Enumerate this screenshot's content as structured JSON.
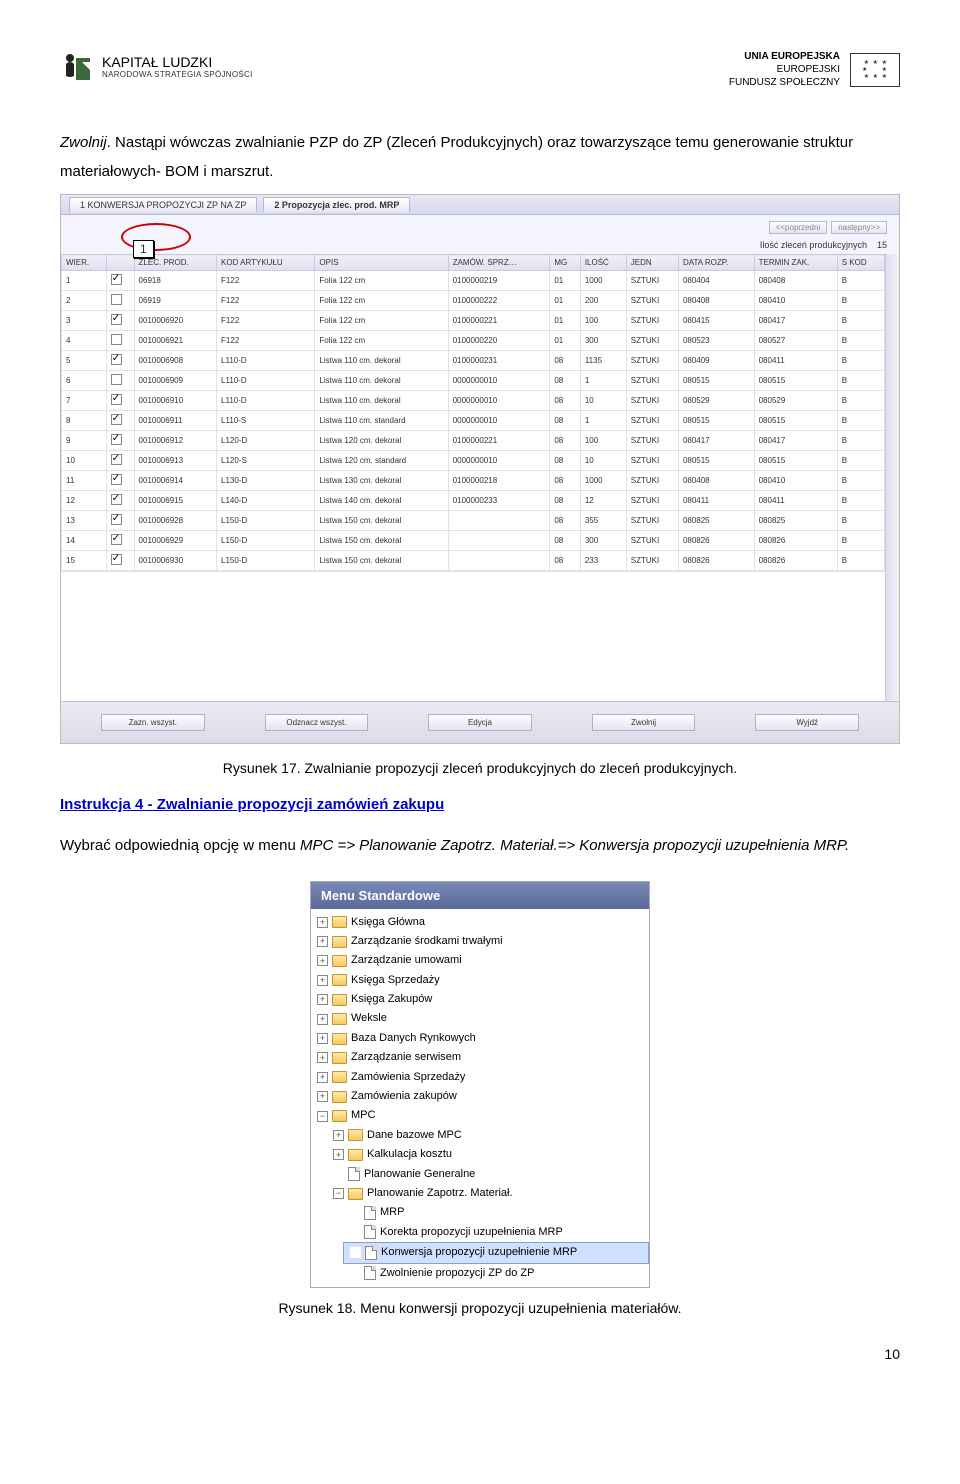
{
  "header": {
    "kl_title": "KAPITAŁ LUDZKI",
    "kl_sub": "NARODOWA STRATEGIA SPÓJNOŚCI",
    "eu_line1": "UNIA EUROPEJSKA",
    "eu_line2": "EUROPEJSKI",
    "eu_line3": "FUNDUSZ SPOŁECZNY"
  },
  "para1_a": "Zwolnij",
  "para1_b": ". Nastąpi wówczas zwalnianie PZP do ZP (Zleceń Produkcyjnych) oraz towarzyszące temu generowanie struktur materiałowych- BOM i marszrut.",
  "callout_num": "1",
  "app": {
    "tab1": "1 KONWERSJA PROPOZYCJI ZP NA ZP",
    "tab2": "2 Propozycja zlec. prod. MRP",
    "prev": "<<poprzedni",
    "next": "następny>>",
    "count_label": "Ilość zleceń produkcyjnych",
    "count_val": "15",
    "columns": [
      "WIER.",
      "",
      "ZLEC. PROD.",
      "KOD ARTYKUŁU",
      "OPIS",
      "ZAMÓW. SPRZ…",
      "MG",
      "ILOŚĆ",
      "JEDN",
      "DATA ROZP.",
      "TERMIN ZAK.",
      "S KOD"
    ],
    "rows": [
      [
        "1",
        true,
        "06918",
        "F122",
        "Folia 122 cm",
        "0100000219",
        "01",
        "1000",
        "SZTUKI",
        "080404",
        "080408",
        "B"
      ],
      [
        "2",
        false,
        "06919",
        "F122",
        "Folia 122 cm",
        "0100000222",
        "01",
        "200",
        "SZTUKI",
        "080408",
        "080410",
        "B"
      ],
      [
        "3",
        true,
        "0010006920",
        "F122",
        "Folia 122 cm",
        "0100000221",
        "01",
        "100",
        "SZTUKI",
        "080415",
        "080417",
        "B"
      ],
      [
        "4",
        false,
        "0010006921",
        "F122",
        "Folia 122 cm",
        "0100000220",
        "01",
        "300",
        "SZTUKI",
        "080523",
        "080527",
        "B"
      ],
      [
        "5",
        true,
        "0010006908",
        "L110-D",
        "Listwa 110 cm. dekoral",
        "0100000231",
        "08",
        "1135",
        "SZTUKI",
        "080409",
        "080411",
        "B"
      ],
      [
        "6",
        false,
        "0010006909",
        "L110-D",
        "Listwa 110 cm. dekoral",
        "0000000010",
        "08",
        "1",
        "SZTUKI",
        "080515",
        "080515",
        "B"
      ],
      [
        "7",
        true,
        "0010006910",
        "L110-D",
        "Listwa 110 cm. dekoral",
        "0000000010",
        "08",
        "10",
        "SZTUKI",
        "080529",
        "080529",
        "B"
      ],
      [
        "8",
        true,
        "0010006911",
        "L110-S",
        "Listwa 110 cm. standard",
        "0000000010",
        "08",
        "1",
        "SZTUKI",
        "080515",
        "080515",
        "B"
      ],
      [
        "9",
        true,
        "0010006912",
        "L120-D",
        "Listwa 120 cm. dekoral",
        "0100000221",
        "08",
        "100",
        "SZTUKI",
        "080417",
        "080417",
        "B"
      ],
      [
        "10",
        true,
        "0010006913",
        "L120-S",
        "Listwa 120 cm. standard",
        "0000000010",
        "08",
        "10",
        "SZTUKI",
        "080515",
        "080515",
        "B"
      ],
      [
        "11",
        true,
        "0010006914",
        "L130-D",
        "Listwa 130 cm. dekoral",
        "0100000218",
        "08",
        "1000",
        "SZTUKI",
        "080408",
        "080410",
        "B"
      ],
      [
        "12",
        true,
        "0010006915",
        "L140-D",
        "Listwa 140 cm. dekoral",
        "0100000233",
        "08",
        "12",
        "SZTUKI",
        "080411",
        "080411",
        "B"
      ],
      [
        "13",
        true,
        "0010006928",
        "L150-D",
        "Listwa 150 cm. dekoral",
        "",
        "08",
        "355",
        "SZTUKI",
        "080825",
        "080825",
        "B"
      ],
      [
        "14",
        true,
        "0010006929",
        "L150-D",
        "Listwa 150 cm. dekoral",
        "",
        "08",
        "300",
        "SZTUKI",
        "080826",
        "080826",
        "B"
      ],
      [
        "15",
        true,
        "0010006930",
        "L150-D",
        "Listwa 150 cm. dekoral",
        "",
        "08",
        "233",
        "SZTUKI",
        "080826",
        "080826",
        "B"
      ]
    ],
    "buttons": [
      "Zazn. wszyst.",
      "Odznacz wszyst.",
      "Edycja",
      "Zwolnij",
      "Wyjdź"
    ]
  },
  "caption1": "Rysunek 17. Zwalnianie propozycji zleceń produkcyjnych do zleceń produkcyjnych.",
  "instr4": "Instrukcja 4 - Zwalnianie propozycji zamówień zakupu",
  "para2_a": "Wybrać odpowiednią opcję w menu ",
  "para2_b": "MPC => Planowanie Zapotrz. Materiał.=> Konwersja propozycji uzupełnienia MRP.",
  "menu": {
    "title": "Menu Standardowe",
    "items": [
      {
        "t": "plus",
        "icon": "folder",
        "label": "Księga Główna",
        "ind": 0
      },
      {
        "t": "plus",
        "icon": "folder",
        "label": "Zarządzanie środkami trwałymi",
        "ind": 0
      },
      {
        "t": "plus",
        "icon": "folder",
        "label": "Zarządzanie umowami",
        "ind": 0
      },
      {
        "t": "plus",
        "icon": "folder",
        "label": "Księga Sprzedaży",
        "ind": 0
      },
      {
        "t": "plus",
        "icon": "folder",
        "label": "Księga Zakupów",
        "ind": 0
      },
      {
        "t": "plus",
        "icon": "folder",
        "label": "Weksle",
        "ind": 0
      },
      {
        "t": "plus",
        "icon": "folder",
        "label": "Baza Danych Rynkowych",
        "ind": 0
      },
      {
        "t": "plus",
        "icon": "folder",
        "label": "Zarządzanie serwisem",
        "ind": 0
      },
      {
        "t": "plus",
        "icon": "folder",
        "label": "Zamówienia Sprzedaży",
        "ind": 0
      },
      {
        "t": "plus",
        "icon": "folder",
        "label": "Zamówienia zakupów",
        "ind": 0
      },
      {
        "t": "minus",
        "icon": "folder",
        "label": "MPC",
        "ind": 0
      },
      {
        "t": "plus",
        "icon": "folder",
        "label": "Dane bazowe MPC",
        "ind": 1
      },
      {
        "t": "plus",
        "icon": "folder",
        "label": "Kalkulacja kosztu",
        "ind": 1
      },
      {
        "t": "empty",
        "icon": "file",
        "label": "Planowanie Generalne",
        "ind": 1
      },
      {
        "t": "minus",
        "icon": "folder",
        "label": "Planowanie Zapotrz. Materiał.",
        "ind": 1
      },
      {
        "t": "empty",
        "icon": "file",
        "label": "MRP",
        "ind": 2
      },
      {
        "t": "empty",
        "icon": "file",
        "label": "Korekta propozycji uzupełnienia MRP",
        "ind": 2
      },
      {
        "t": "empty",
        "icon": "file",
        "label": "Konwersja propozycji uzupełnienie MRP",
        "ind": 2,
        "sel": true
      },
      {
        "t": "empty",
        "icon": "file",
        "label": "Zwolnienie propozycji ZP do ZP",
        "ind": 2
      }
    ]
  },
  "caption2": "Rysunek 18. Menu konwersji propozycji uzupełnienia materiałów.",
  "page_num": "10"
}
